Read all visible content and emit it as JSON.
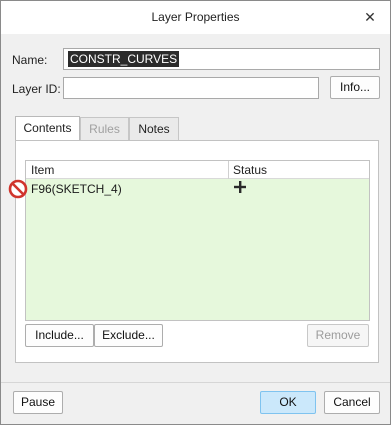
{
  "window": {
    "title": "Layer Properties",
    "close_icon": "close-icon"
  },
  "form": {
    "name_label": "Name:",
    "name_value": "CONSTR_CURVES",
    "layer_id_label": "Layer ID:",
    "layer_id_value": "",
    "info_button": "Info..."
  },
  "tabs": [
    {
      "label": "Contents",
      "active": true,
      "enabled": true
    },
    {
      "label": "Rules",
      "active": false,
      "enabled": false
    },
    {
      "label": "Notes",
      "active": false,
      "enabled": true
    }
  ],
  "table": {
    "columns": [
      "Item",
      "Status"
    ],
    "rows": [
      {
        "item": "F96(SKETCH_4)",
        "status_icon": "plus-icon",
        "row_icon": "no-entry-icon"
      }
    ],
    "background_color": "#e6f8dc"
  },
  "panel_buttons": {
    "include": "Include...",
    "exclude": "Exclude...",
    "remove": "Remove"
  },
  "footer": {
    "pause": "Pause",
    "ok": "OK",
    "cancel": "Cancel"
  },
  "colors": {
    "accent_button": "#cbe8fb",
    "no_entry_red": "#d0342c"
  }
}
